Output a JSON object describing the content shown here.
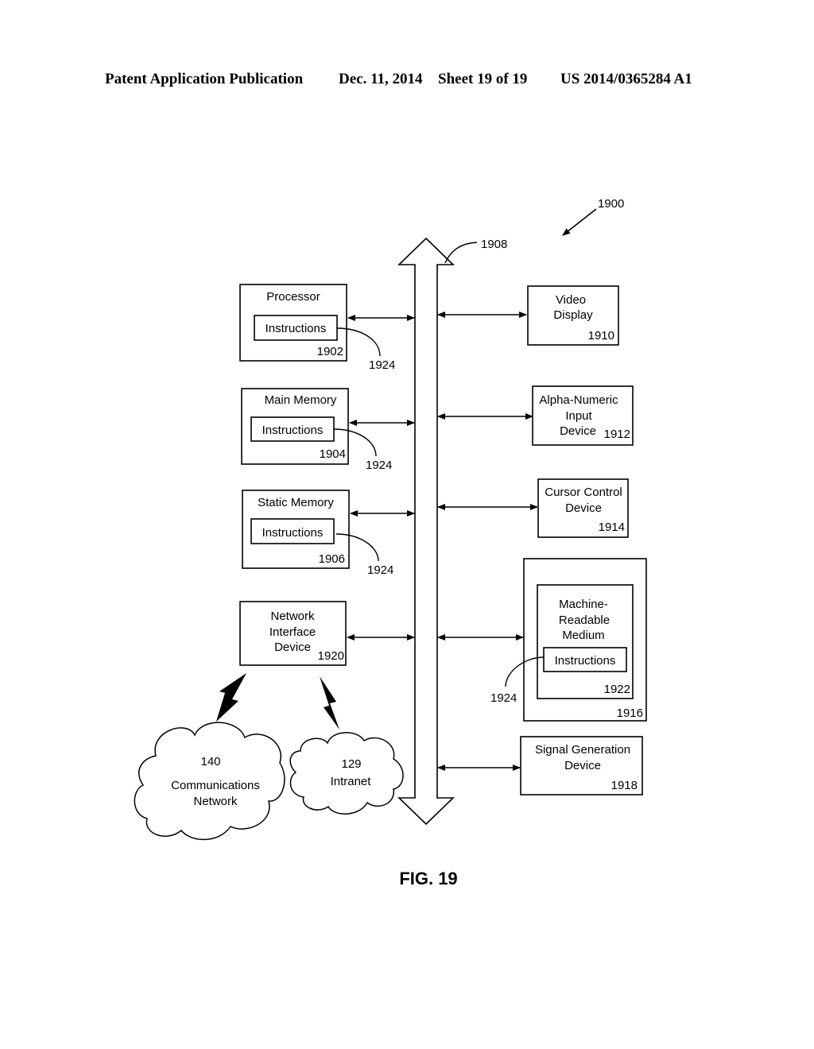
{
  "header": {
    "publication": "Patent Application Publication",
    "date": "Dec. 11, 2014",
    "sheet": "Sheet 19 of 19",
    "number": "US 2014/0365284 A1"
  },
  "figure": {
    "caption": "FIG. 19",
    "system_ref": "1900",
    "bus_ref": "1908",
    "left_components": [
      {
        "name": "Processor",
        "ref": "1902",
        "inner": "Instructions",
        "inner_ref": "1924"
      },
      {
        "name": "Main Memory",
        "ref": "1904",
        "inner": "Instructions",
        "inner_ref": "1924"
      },
      {
        "name": "Static Memory",
        "ref": "1906",
        "inner": "Instructions",
        "inner_ref": "1924"
      },
      {
        "name_lines": [
          "Network",
          "Interface",
          "Device"
        ],
        "ref": "1920"
      }
    ],
    "right_components": [
      {
        "name_lines": [
          "Video",
          "Display"
        ],
        "ref": "1910"
      },
      {
        "name_lines": [
          "Alpha-Numeric",
          "Input",
          "Device"
        ],
        "ref": "1912"
      },
      {
        "name_lines": [
          "Cursor Control",
          "Device"
        ],
        "ref": "1914"
      },
      {
        "outer_ref": "1916",
        "name_lines": [
          "Machine-",
          "Readable",
          "Medium"
        ],
        "ref": "1922",
        "inner": "Instructions",
        "inner_ref": "1924"
      },
      {
        "name_lines": [
          "Signal Generation",
          "Device"
        ],
        "ref": "1918"
      }
    ],
    "networks": [
      {
        "ref": "140",
        "name_lines": [
          "Communications",
          "Network"
        ]
      },
      {
        "ref": "129",
        "name": "Intranet"
      }
    ]
  }
}
